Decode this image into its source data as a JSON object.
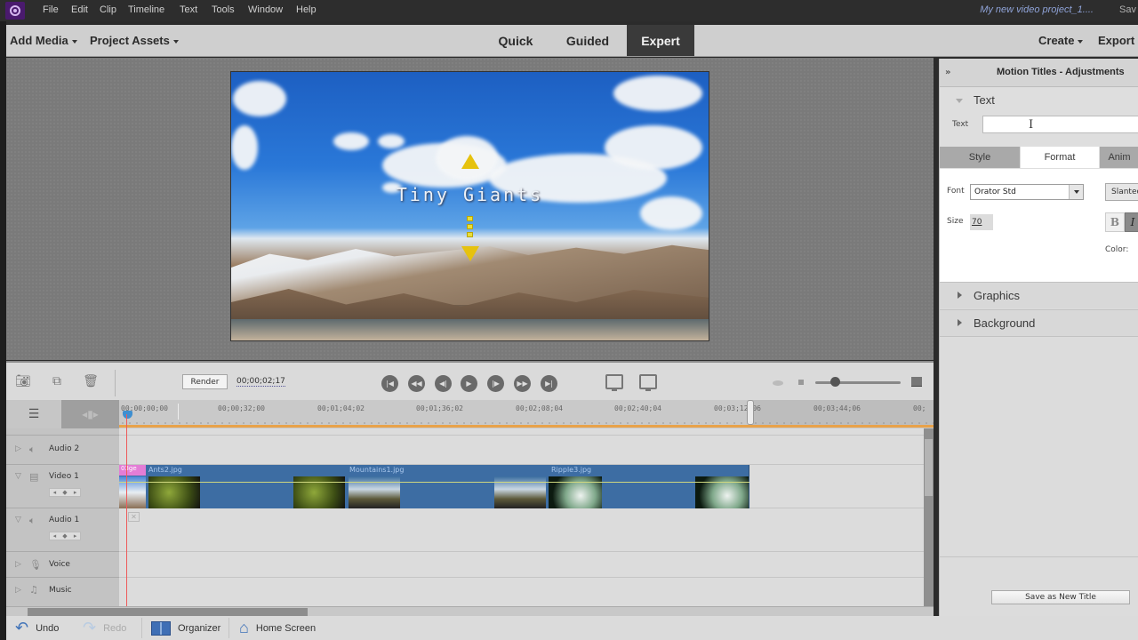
{
  "app": {
    "menu": [
      "File",
      "Edit",
      "Clip",
      "Timeline",
      "Text",
      "Tools",
      "Window",
      "Help"
    ],
    "project_name": "My new video project_1....",
    "save_label": "Sav"
  },
  "toolbar": {
    "add_media": "Add Media",
    "project_assets": "Project Assets",
    "modes": [
      "Quick",
      "Guided",
      "Expert"
    ],
    "active_mode": "Expert",
    "create": "Create",
    "export": "Export"
  },
  "preview": {
    "title_text": "Tiny Giants"
  },
  "panel": {
    "title": "Motion Titles - Adjustments",
    "text_section": "Text",
    "text_label": "Text",
    "text_value": "",
    "tabs": [
      "Style",
      "Format",
      "Anim"
    ],
    "active_tab": "Format",
    "font_label": "Font",
    "font_value": "Orator Std",
    "style_value": "Slanted",
    "size_label": "Size",
    "size_value": "70",
    "bold_label": "B",
    "italic_label": "I",
    "color_label": "Color:",
    "graphics": "Graphics",
    "background": "Background",
    "save_new_title": "Save as New Title"
  },
  "timeline": {
    "render": "Render",
    "timecode": "00;00;02;17",
    "ruler_ticks": [
      "00;00;00;00",
      "00;00;32;00",
      "00;01;04;02",
      "00;01;36;02",
      "00;02;08;04",
      "00;02;40;04",
      "00;03;12;06",
      "00;03;44;06",
      "00;"
    ],
    "tracks": [
      {
        "name": "Audio 2",
        "type": "audio"
      },
      {
        "name": "Video 1",
        "type": "video"
      },
      {
        "name": "Audio 1",
        "type": "audio"
      },
      {
        "name": "Voice",
        "type": "voice"
      },
      {
        "name": "Music",
        "type": "music"
      }
    ],
    "clips": [
      {
        "name": "03ge",
        "kind": "title"
      },
      {
        "name": "Ants2.jpg"
      },
      {
        "name": "Mountains1.jpg"
      },
      {
        "name": "Ripple3.jpg"
      }
    ]
  },
  "footer": {
    "undo": "Undo",
    "redo": "Redo",
    "organizer": "Organizer",
    "home_screen": "Home Screen"
  }
}
